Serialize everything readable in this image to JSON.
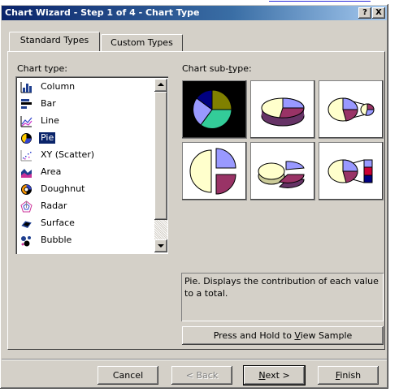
{
  "window": {
    "title": "Chart Wizard - Step 1 of 4 - Chart Type",
    "help_button": "?",
    "close_button": "X"
  },
  "tabs": [
    {
      "label": "Standard Types",
      "active": true
    },
    {
      "label": "Custom Types",
      "active": false
    }
  ],
  "chart_type": {
    "label": "Chart type:",
    "selected": "Pie",
    "items": [
      {
        "label": "Column",
        "icon": "column-chart-icon"
      },
      {
        "label": "Bar",
        "icon": "bar-chart-icon"
      },
      {
        "label": "Line",
        "icon": "line-chart-icon"
      },
      {
        "label": "Pie",
        "icon": "pie-chart-icon"
      },
      {
        "label": "XY (Scatter)",
        "icon": "scatter-chart-icon"
      },
      {
        "label": "Area",
        "icon": "area-chart-icon"
      },
      {
        "label": "Doughnut",
        "icon": "doughnut-chart-icon"
      },
      {
        "label": "Radar",
        "icon": "radar-chart-icon"
      },
      {
        "label": "Surface",
        "icon": "surface-chart-icon"
      },
      {
        "label": "Bubble",
        "icon": "bubble-chart-icon"
      }
    ]
  },
  "chart_subtype": {
    "label_pre": "Chart sub-",
    "label_mnemonic": "t",
    "label_post": "ype:",
    "options": [
      {
        "name": "pie",
        "selected": true
      },
      {
        "name": "3d-pie",
        "selected": false
      },
      {
        "name": "pie-of-pie",
        "selected": false
      },
      {
        "name": "exploded-pie",
        "selected": false
      },
      {
        "name": "exploded-3d-pie",
        "selected": false
      },
      {
        "name": "bar-of-pie",
        "selected": false
      }
    ],
    "description": "Pie. Displays the contribution of each value to a total."
  },
  "buttons": {
    "view_sample_pre": "Press and Hold to ",
    "view_sample_mnemonic": "V",
    "view_sample_post": "iew Sample",
    "cancel": "Cancel",
    "back": "< Back",
    "next_mnemonic": "N",
    "next_post": "ext >",
    "finish_mnemonic": "F",
    "finish_post": "inish"
  },
  "colors": {
    "title_bar": "#0a246a",
    "dialog_face": "#d4d0c8",
    "selection": "#0a246a",
    "pie_periwinkle": "#9999ff",
    "pie_plum": "#993366",
    "pie_cream": "#ffffcc",
    "pie_olive": "#808000",
    "pie_sea": "#33cc99"
  }
}
